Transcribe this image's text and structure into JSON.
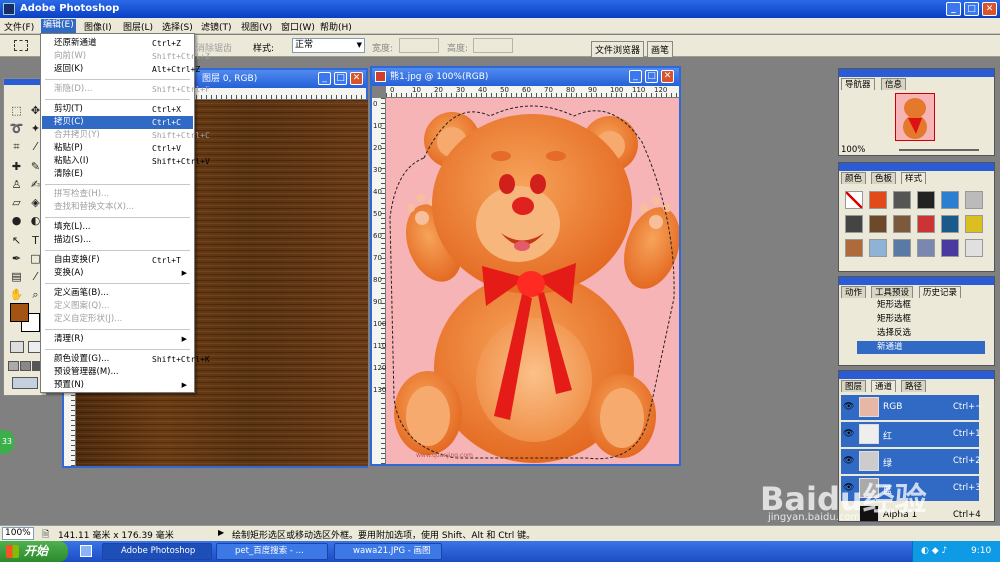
{
  "app": {
    "title": "Adobe Photoshop"
  },
  "menubar": {
    "items": [
      "文件(F)",
      "编辑(E)",
      "图像(I)",
      "图层(L)",
      "选择(S)",
      "滤镜(T)",
      "视图(V)",
      "窗口(W)",
      "帮助(H)"
    ]
  },
  "options": {
    "feather_label": "羽化",
    "antialias_label": "消除锯齿",
    "style_label": "样式:",
    "style_value": "正常",
    "width_label": "宽度:",
    "height_label": "高度:",
    "tab_browser": "文件浏览器",
    "tab_brush": "画笔"
  },
  "edit_menu": {
    "items": [
      {
        "label": "还原新通道",
        "shortcut": "Ctrl+Z"
      },
      {
        "label": "向前(W)",
        "shortcut": "Shift+Ctrl+Z"
      },
      {
        "label": "返回(K)",
        "shortcut": "Alt+Ctrl+Z"
      },
      {
        "label": "渐隐(D)...",
        "shortcut": "Shift+Ctrl+F"
      },
      {
        "label": "剪切(T)",
        "shortcut": "Ctrl+X"
      },
      {
        "label": "拷贝(C)",
        "shortcut": "Ctrl+C"
      },
      {
        "label": "合并拷贝(Y)",
        "shortcut": "Shift+Ctrl+C"
      },
      {
        "label": "粘贴(P)",
        "shortcut": "Ctrl+V"
      },
      {
        "label": "粘贴入(I)",
        "shortcut": "Shift+Ctrl+V"
      },
      {
        "label": "清除(E)",
        "shortcut": ""
      },
      {
        "label": "拼写检查(H)...",
        "shortcut": ""
      },
      {
        "label": "查找和替换文本(X)...",
        "shortcut": ""
      },
      {
        "label": "填充(L)...",
        "shortcut": ""
      },
      {
        "label": "描边(S)...",
        "shortcut": ""
      },
      {
        "label": "自由变换(F)",
        "shortcut": "Ctrl+T"
      },
      {
        "label": "变换(A)",
        "shortcut": ""
      },
      {
        "label": "定义画笔(B)...",
        "shortcut": ""
      },
      {
        "label": "定义图案(Q)...",
        "shortcut": ""
      },
      {
        "label": "定义自定形状(J)...",
        "shortcut": ""
      },
      {
        "label": "清理(R)",
        "shortcut": ""
      },
      {
        "label": "颜色设置(G)...",
        "shortcut": "Shift+Ctrl+K"
      },
      {
        "label": "预设管理器(M)...",
        "shortcut": ""
      },
      {
        "label": "预置(N)",
        "shortcut": ""
      }
    ]
  },
  "doc_left": {
    "title": "图层 0, RGB)"
  },
  "doc_right": {
    "title": "熊1.jpg @ 100%(RGB)"
  },
  "ruler": {
    "nums": [
      "0",
      "10",
      "20",
      "30",
      "40",
      "50",
      "60",
      "70",
      "80",
      "90",
      "100",
      "110",
      "120"
    ],
    "vnums": [
      "0",
      "10",
      "20",
      "30",
      "40",
      "50",
      "60",
      "70",
      "80",
      "90",
      "100",
      "110",
      "120",
      "130"
    ]
  },
  "navigator": {
    "tabs": [
      "导航器",
      "信息"
    ],
    "zoom": "100%"
  },
  "color_palette": {
    "tabs": [
      "颜色",
      "色板",
      "样式"
    ]
  },
  "history": {
    "tabs": [
      "动作",
      "工具预设",
      "历史记录"
    ],
    "items": [
      "矩形选框",
      "矩形选框",
      "选择反选",
      "新通道"
    ]
  },
  "channels": {
    "tabs": [
      "图层",
      "通道",
      "路径"
    ],
    "rows": [
      {
        "name": "RGB",
        "shortcut": "Ctrl+~"
      },
      {
        "name": "红",
        "shortcut": "Ctrl+1"
      },
      {
        "name": "绿",
        "shortcut": "Ctrl+2"
      },
      {
        "name": "蓝",
        "shortcut": "Ctrl+3"
      },
      {
        "name": "Alpha 1",
        "shortcut": "Ctrl+4"
      }
    ]
  },
  "status": {
    "zoom": "100%",
    "doc_size": "141.11 毫米 x 176.39 毫米",
    "hint": "绘制矩形选区或移动选区外框。要用附加选项，使用 Shift、Alt 和 Ctrl 键。"
  },
  "taskbar": {
    "start": "开始",
    "tasks": [
      "Adobe Photoshop",
      "pet_百度搜索 - ...",
      "wawa21.JPG - 画图"
    ],
    "time": "9:10"
  },
  "watermark": {
    "text": "Baidu经验",
    "url": "jingyan.baidu.com"
  },
  "badge": "33",
  "canvas_credit": "www.quanjing.com",
  "colors": {
    "accent": "#316ac5",
    "title_blue": "#0a3fc4",
    "wood": "#5a3312",
    "canvas_pink": "#f7b4b7",
    "bear": "#f07a2a",
    "ribbon": "#e41b17"
  }
}
